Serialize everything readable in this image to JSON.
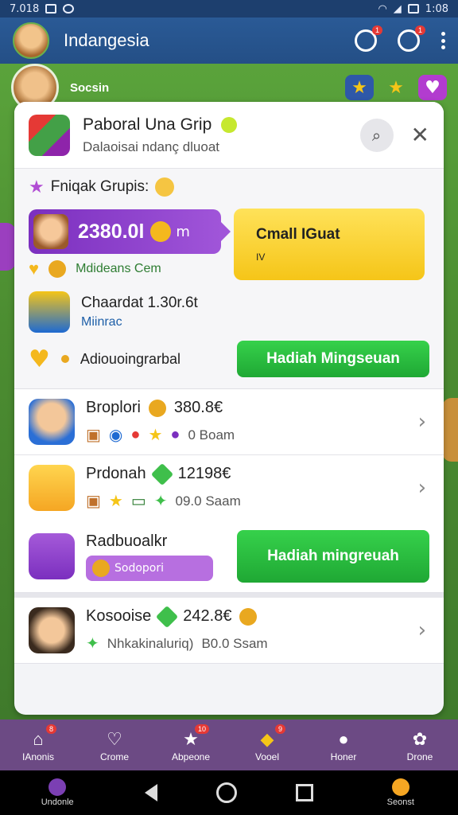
{
  "status_bar": {
    "time_left": "7.018",
    "time_right": "1:08"
  },
  "app_bar": {
    "title": "Indangesia",
    "notif_badge": "1",
    "search_badge": "1"
  },
  "sub_header": {
    "label": "Socsin"
  },
  "card": {
    "title": "Paboral Una  Grip",
    "subtitle": "Dalaoisai ndanç dluoat",
    "section_title": "Fniqak Grupis:",
    "purple_amount": "2380.0l",
    "purple_suffix": "m",
    "yellow_button": {
      "title": "Cmall IGuat",
      "sub": "IV"
    },
    "mini_row_text": "Mdideans Cem",
    "item1": {
      "name": "Chaardat",
      "value": "1.30r.6t",
      "sub": "Miinrac"
    },
    "item2": {
      "name": "Adiouoingrarbal"
    },
    "green_button_1": "Hadiah Mingseuan"
  },
  "list": [
    {
      "title": "Broplori",
      "value": "380.8€",
      "meta": "0 Boam"
    },
    {
      "title": "Prdonah",
      "value": "12198€",
      "meta": "09.0 Saam"
    },
    {
      "title": "Radbuoalkr",
      "pill_text": "Sodopori",
      "button": "Hadiah mingreuah"
    },
    {
      "title": "Kosooise",
      "value": "242.8€",
      "meta": "Nhkakinaluriq)",
      "meta2": "B0.0 Ssam"
    }
  ],
  "bottom_nav": [
    {
      "label": "IAnonis",
      "badge": "8"
    },
    {
      "label": "Crome",
      "badge": ""
    },
    {
      "label": "Abpeone",
      "badge": "10"
    },
    {
      "label": "Vooel",
      "badge": "9"
    },
    {
      "label": "Honer",
      "badge": ""
    },
    {
      "label": "Drone",
      "badge": ""
    }
  ],
  "system_nav": {
    "left_label": "Undonle",
    "right_label": "Seonst"
  },
  "colors": {
    "purple": "#7b2fbf",
    "green": "#1fa834",
    "yellow": "#f5c518",
    "nav": "#6c4a84"
  }
}
